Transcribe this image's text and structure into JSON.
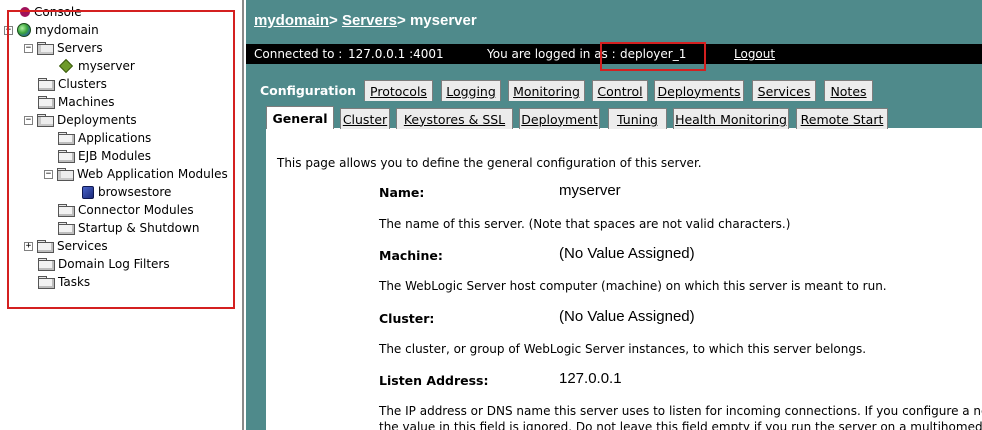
{
  "tree": {
    "console": "Console",
    "domain": "mydomain",
    "servers": "Servers",
    "server": "myserver",
    "clusters": "Clusters",
    "machines": "Machines",
    "deployments": "Deployments",
    "applications": "Applications",
    "ejb_modules": "EJB Modules",
    "web_modules": "Web Application Modules",
    "web_app": "browsestore",
    "connector_modules": "Connector Modules",
    "startup_shutdown": "Startup & Shutdown",
    "services": "Services",
    "domain_log_filters": "Domain Log Filters",
    "tasks": "Tasks",
    "toggle_expanded": "−",
    "toggle_collapsed": "+"
  },
  "header": {
    "crumb_domain": "mydomain",
    "sep1": ">",
    "crumb_servers": "Servers",
    "sep2": ">",
    "current": "myserver"
  },
  "status": {
    "connected_label": "Connected to :",
    "address": "127.0.0.1 :4001",
    "logged_in_label": "You are logged in as :",
    "user": "deployer_1",
    "logout": "Logout"
  },
  "tabs": [
    "Configuration",
    "Protocols",
    "Logging",
    "Monitoring",
    "Control",
    "Deployments",
    "Services",
    "Notes"
  ],
  "subtabs": [
    "General",
    "Cluster",
    "Keystores & SSL",
    "Deployment",
    "Tuning",
    "Health Monitoring",
    "Remote Start"
  ],
  "content": {
    "intro": "This page allows you to define the general configuration of this server.",
    "name_label": "Name:",
    "name_value": "myserver",
    "name_help": "The name of this server. (Note that spaces are not valid characters.)",
    "machine_label": "Machine:",
    "machine_value": "(No Value Assigned)",
    "machine_help": "The WebLogic Server host computer (machine) on which this server is meant to run.",
    "cluster_label": "Cluster:",
    "cluster_value": "(No Value Assigned)",
    "cluster_help": "The cluster, or group of WebLogic Server instances, to which this server belongs.",
    "listen_label": "Listen Address:",
    "listen_value": "127.0.0.1",
    "listen_help_1": "The IP address or DNS name this server uses to listen for incoming connections. If you configure a network",
    "listen_help_2": "the value in this field is ignored. Do not leave this field empty if you run the server on a multihomed compu"
  },
  "colors": {
    "accent": "#4f8a8b",
    "highlight": "#d42020"
  }
}
